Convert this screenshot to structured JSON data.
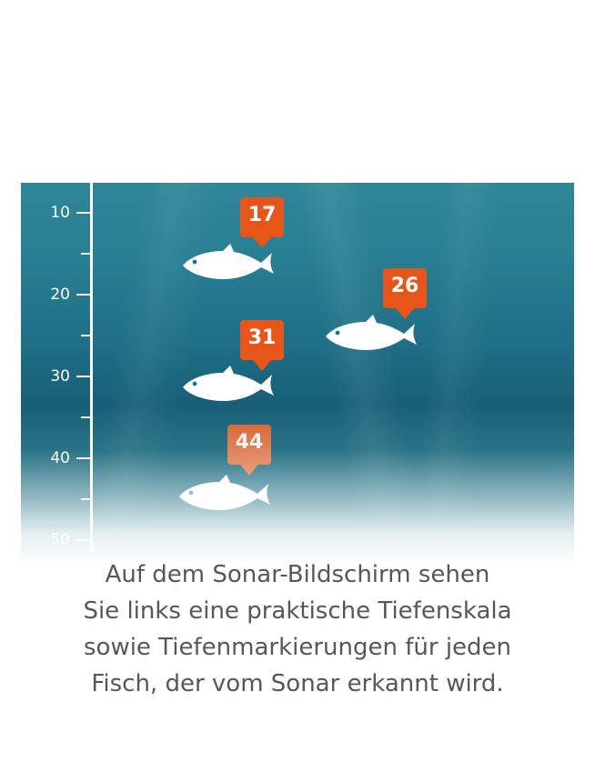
{
  "sonar": {
    "depth_scale": {
      "labels": [
        "10",
        "20",
        "30",
        "40",
        "50"
      ]
    },
    "fish": [
      {
        "depth_label": "17",
        "marker_color": "#e8551a"
      },
      {
        "depth_label": "26",
        "marker_color": "#e8551a"
      },
      {
        "depth_label": "31",
        "marker_color": "#e8551a"
      },
      {
        "depth_label": "44",
        "marker_color": "#ec7a4e"
      }
    ],
    "colors": {
      "water_top": "#2f8799",
      "water_mid": "#175f77",
      "marker": "#e8551a",
      "fish": "#ffffff"
    }
  },
  "caption": {
    "line1": "Auf dem Sonar-Bildschirm sehen",
    "line2": "Sie links eine praktische Tiefenskala",
    "line3": "sowie Tiefenmarkierungen für jeden",
    "line4": "Fisch, der vom Sonar erkannt wird."
  }
}
